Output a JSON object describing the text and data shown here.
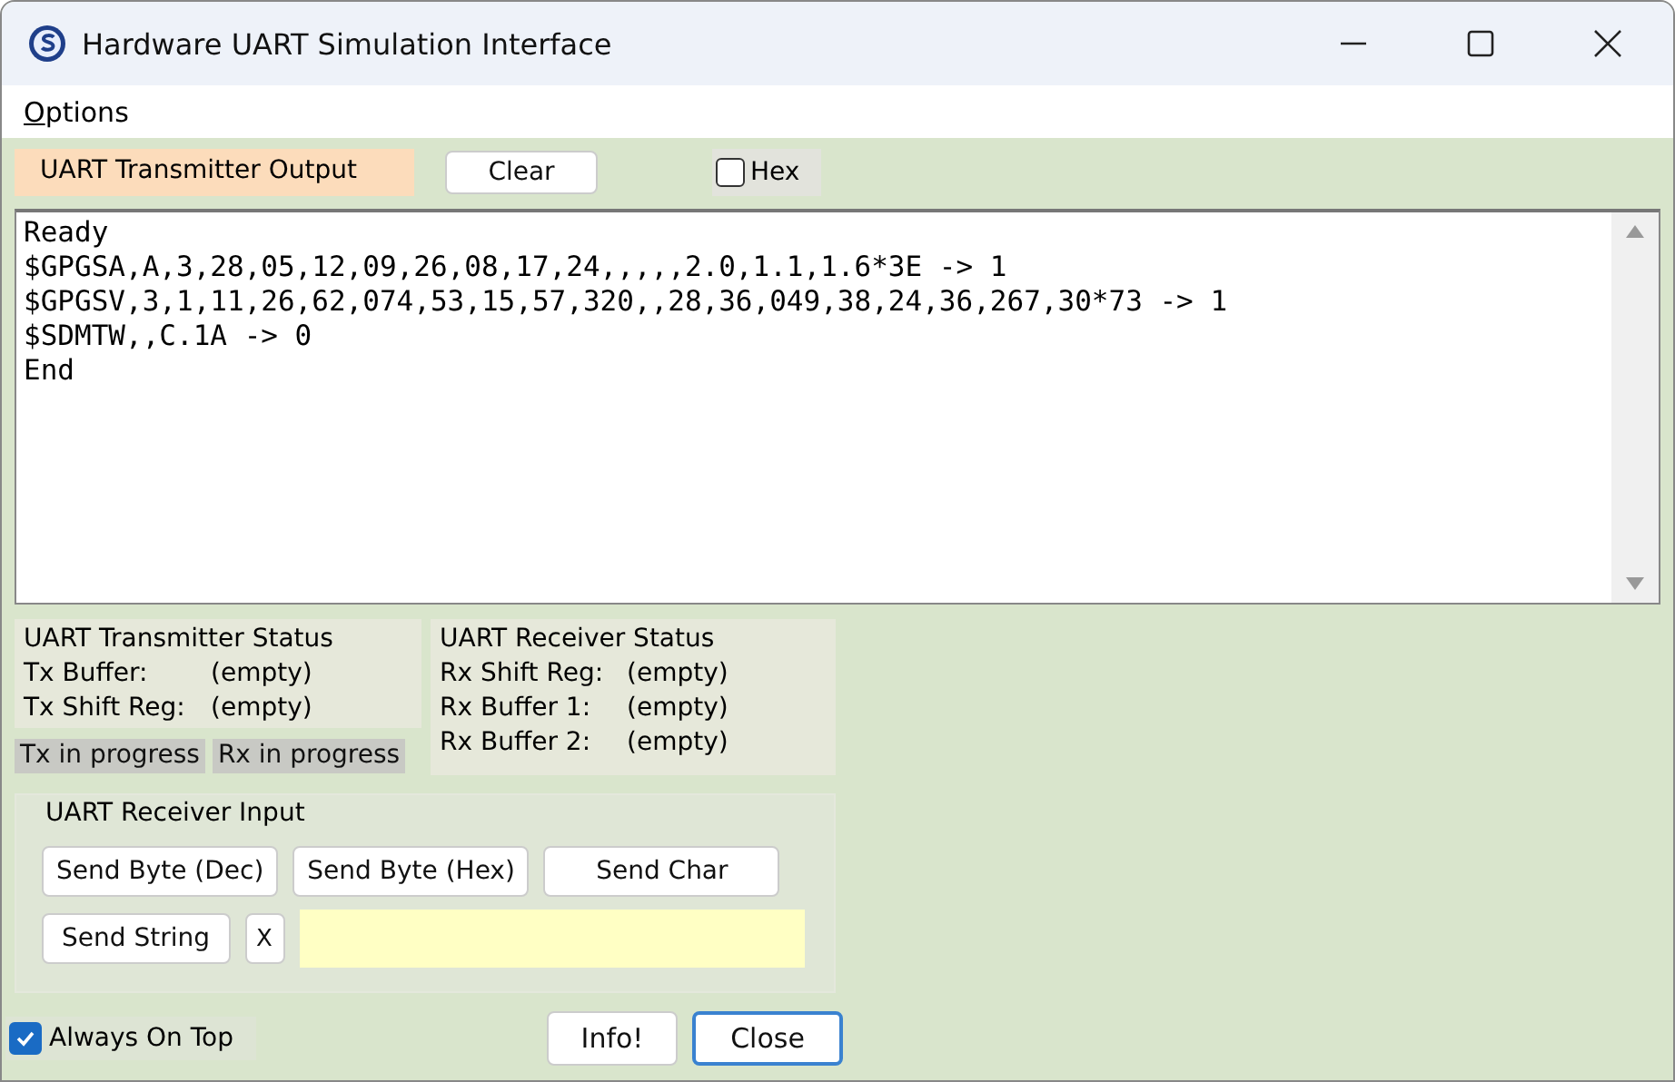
{
  "window": {
    "title": "Hardware UART Simulation Interface"
  },
  "menu": [
    {
      "label": "Options"
    }
  ],
  "output": {
    "label": "UART Transmitter Output",
    "clear_button": "Clear",
    "hex": {
      "label": "Hex",
      "checked": false
    },
    "lines": [
      "Ready",
      "$GPGSA,A,3,28,05,12,09,26,08,17,24,,,,,2.0,1.1,1.6*3E -> 1",
      "$GPGSV,3,1,11,26,62,074,53,15,57,320,,28,36,049,38,24,36,267,30*73 -> 1",
      "$SDMTW,,C.1A -> 0",
      "End"
    ]
  },
  "tx_status": {
    "title": "UART Transmitter Status",
    "rows": [
      {
        "label": "Tx Buffer:",
        "value": "(empty)"
      },
      {
        "label": "Tx Shift Reg:",
        "value": "(empty)"
      }
    ]
  },
  "progress": [
    {
      "label": "Tx in progress",
      "active": false
    },
    {
      "label": "Rx in progress",
      "active": false
    }
  ],
  "rx_status": {
    "title": "UART Receiver Status",
    "rows": [
      {
        "label": "Rx Shift Reg:",
        "value": "(empty)"
      },
      {
        "label": "Rx Buffer 1:",
        "value": "(empty)"
      },
      {
        "label": "Rx Buffer 2:",
        "value": "(empty)"
      }
    ]
  },
  "input": {
    "title": "UART Receiver Input",
    "buttons": [
      "Send Byte (Dec)",
      "Send Byte (Hex)",
      "Send Char"
    ],
    "send_string": "Send String",
    "clear_x": "X"
  },
  "always_on_top": {
    "label": "Always On Top",
    "checked": true
  },
  "buttons": [
    {
      "label": "Info!",
      "default": false
    },
    {
      "label": "Close",
      "default": true
    }
  ]
}
